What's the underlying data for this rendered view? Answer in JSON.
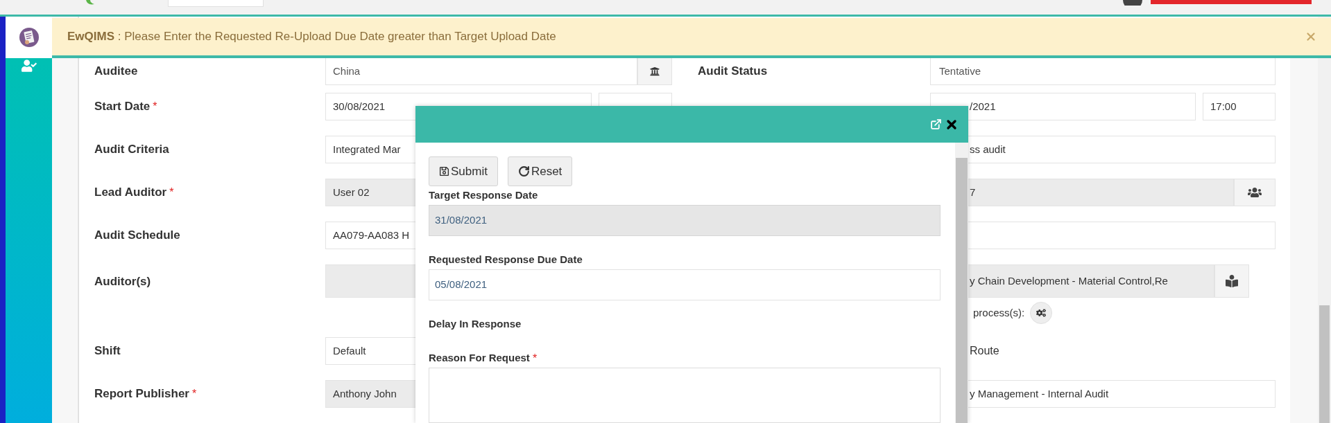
{
  "alert": {
    "text": "**EwQIMS** : Please Enter the Requested Re-Upload Due Date greater than Target Upload Date"
  },
  "sidebar": {
    "items": [
      {
        "kind": "document",
        "selected": true
      },
      {
        "kind": "user_check",
        "selected": false
      }
    ]
  },
  "form": {
    "left": [
      {
        "kind": "lookup",
        "label": "Auditee",
        "value": "China",
        "readonly": false
      },
      {
        "kind": "datetime",
        "label": "Start Date",
        "mark": "*",
        "value": "30/08/2021",
        "readonly": false
      },
      {
        "kind": "field",
        "label": "Audit Criteria",
        "value": "Integrated Mar",
        "readonly": false
      },
      {
        "kind": "field",
        "label": "Lead Auditor",
        "mark": "*",
        "value": "User 02",
        "readonly": true
      },
      {
        "kind": "field",
        "label": "Audit Schedule",
        "value": "AA079-AA083 H",
        "readonly": false
      },
      {
        "kind": "multi",
        "label": "Auditor(s)",
        "readonly": true
      },
      {
        "kind": "field",
        "label": "Shift",
        "value": "Default",
        "readonly": false
      },
      {
        "kind": "field",
        "label": "Report Publisher",
        "mark": "*",
        "value": "Anthony John",
        "readonly": true
      }
    ],
    "right": [
      {
        "kind": "select",
        "label": "Audit Status",
        "value": "Tentative",
        "readonly": false
      },
      {
        "kind": "datetime",
        "value": "/2021",
        "time": "17:00",
        "readonly": false
      },
      {
        "kind": "field",
        "value": "ss audit",
        "readonly": false
      },
      {
        "kind": "team",
        "value": "7",
        "readonly": true
      },
      {
        "kind": "field",
        "readonly": false
      },
      {
        "kind": "multi",
        "value": "y Chain Development - Material Control,Re",
        "readonly": true,
        "note": "process(s):"
      },
      {
        "kind": "note",
        "value": "Route"
      },
      {
        "kind": "field",
        "value": "y Management - Internal Audit",
        "readonly": false
      }
    ]
  },
  "modal": {
    "buttons": [
      {
        "kind": "save",
        "label": "Submit"
      },
      {
        "kind": "reset",
        "label": "Reset"
      }
    ],
    "fields": [
      {
        "kind": "field",
        "label": "Target Response Date",
        "value": "31/08/2021",
        "readonly": true
      },
      {
        "kind": "field",
        "label": "Requested Response Due Date",
        "value": "05/08/2021",
        "readonly": false
      },
      {
        "kind": "label",
        "label": "Delay In Response"
      },
      {
        "kind": "textarea",
        "label": "Reason For Request",
        "mark": "*"
      }
    ]
  }
}
